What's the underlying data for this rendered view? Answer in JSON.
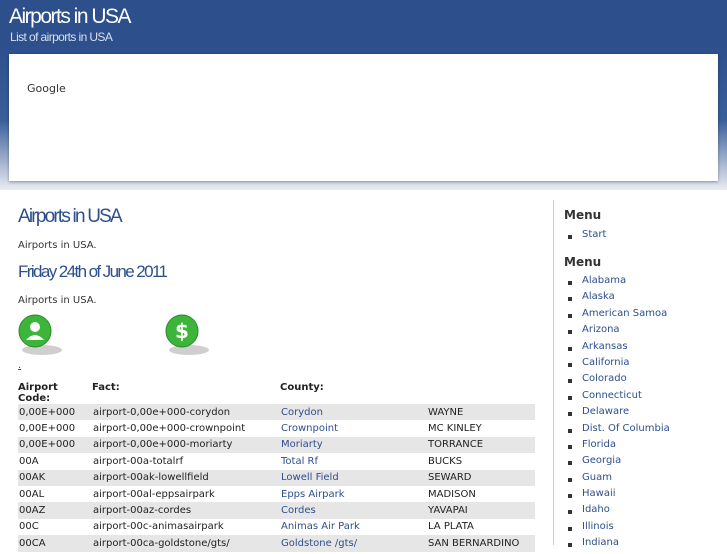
{
  "header": {
    "site_title": "Airports in USA",
    "site_subtitle": "List of airports in USA"
  },
  "ad": {
    "label": "Google"
  },
  "main": {
    "title": "Airports in USA",
    "intro": "Airports in USA.",
    "date_heading": "Friday 24th of June 2011",
    "intro2": "Airports in USA.",
    "icons": [
      "user-icon",
      "dollar-icon"
    ],
    "dot_link": ".",
    "table": {
      "headers": [
        "Airport Code:",
        "Fact:",
        "County:",
        ""
      ],
      "rows": [
        [
          "0,00E+000",
          "airport-0,00e+000-corydon",
          "Corydon",
          "WAYNE"
        ],
        [
          "0,00E+000",
          "airport-0,00e+000-crownpoint",
          "Crownpoint",
          "MC KINLEY"
        ],
        [
          "0,00E+000",
          "airport-0,00e+000-moriarty",
          "Moriarty",
          "TORRANCE"
        ],
        [
          "00A",
          "airport-00a-totalrf",
          "Total Rf",
          "BUCKS"
        ],
        [
          "00AK",
          "airport-00ak-lowellfield",
          "Lowell Field",
          "SEWARD"
        ],
        [
          "00AL",
          "airport-00al-eppsairpark",
          "Epps Airpark",
          "MADISON"
        ],
        [
          "00AZ",
          "airport-00az-cordes",
          "Cordes",
          "YAVAPAI"
        ],
        [
          "00C",
          "airport-00c-animasairpark",
          "Animas Air Park",
          "LA PLATA"
        ],
        [
          "00CA",
          "airport-00ca-goldstone/gts/",
          "Goldstone /gts/",
          "SAN BERNARDINO"
        ]
      ]
    }
  },
  "sidebar": {
    "menu1_title": "Menu",
    "menu1_items": [
      "Start"
    ],
    "menu2_title": "Menu",
    "menu2_items": [
      "Alabama",
      "Alaska",
      "American Samoa",
      "Arizona",
      "Arkansas",
      "California",
      "Colorado",
      "Connecticut",
      "Delaware",
      "Dist. Of Columbia",
      "Florida",
      "Georgia",
      "Guam",
      "Hawaii",
      "Idaho",
      "Illinois",
      "Indiana"
    ]
  },
  "colors": {
    "header_blue": "#2d4f8c",
    "link_blue": "#2d4f8c",
    "user_icon_green": "#3db53a",
    "row_stripe": "#e6e6e6"
  }
}
